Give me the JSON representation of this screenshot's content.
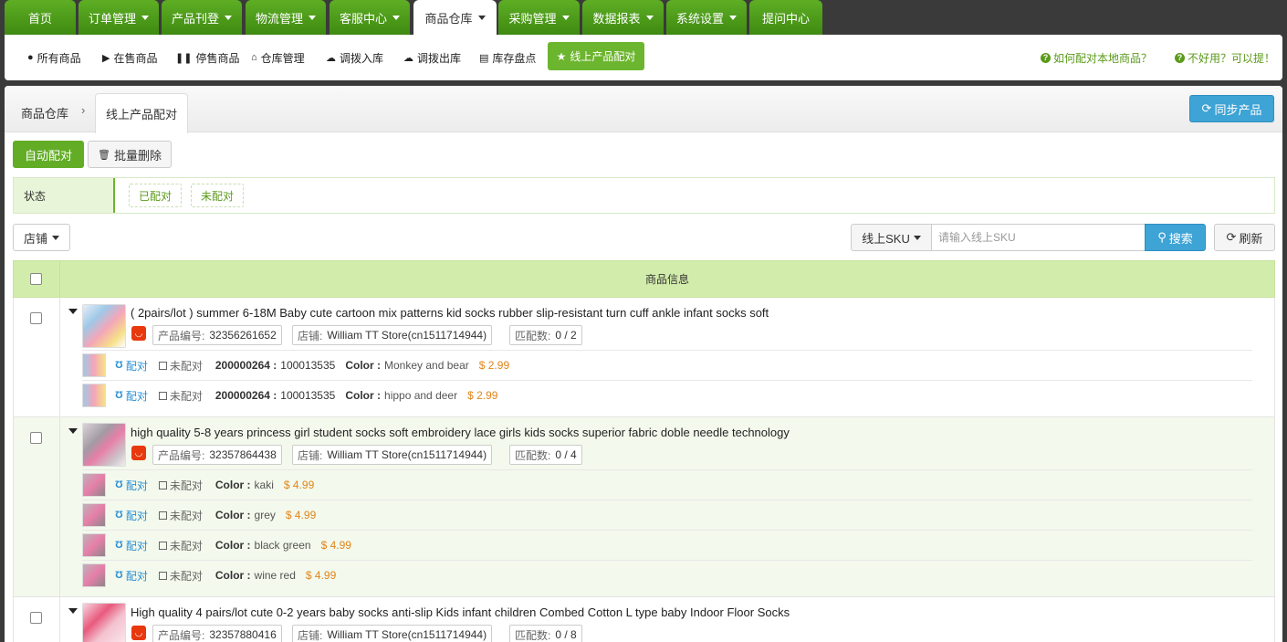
{
  "topnav": {
    "tabs": [
      {
        "label": "首页",
        "dropdown": false
      },
      {
        "label": "订单管理",
        "dropdown": true
      },
      {
        "label": "产品刊登",
        "dropdown": true
      },
      {
        "label": "物流管理",
        "dropdown": true
      },
      {
        "label": "客服中心",
        "dropdown": true
      },
      {
        "label": "商品仓库",
        "dropdown": true,
        "active": true
      },
      {
        "label": "采购管理",
        "dropdown": true
      },
      {
        "label": "数据报表",
        "dropdown": true
      },
      {
        "label": "系统设置",
        "dropdown": true
      },
      {
        "label": "提问中心",
        "dropdown": false
      }
    ]
  },
  "subnav": {
    "items": [
      "所有商品",
      "在售商品",
      "停售商品",
      "仓库管理",
      "调拨入库",
      "调拨出库",
      "库存盘点"
    ],
    "active": "线上产品配对",
    "help1": "如何配对本地商品？",
    "help2": "不好用？可以提！"
  },
  "breadcrumb": {
    "root": "商品仓库",
    "sep": "›",
    "current": "线上产品配对"
  },
  "actions": {
    "sync": "同步产品",
    "auto_match": "自动配对",
    "batch_delete": "批量删除"
  },
  "filter": {
    "label": "状态",
    "options": [
      "已配对",
      "未配对"
    ]
  },
  "toolbar": {
    "shop": "店铺",
    "sku_type": "线上SKU",
    "search_placeholder": "请输入线上SKU",
    "search": "搜索",
    "refresh": "刷新"
  },
  "table": {
    "header": "商品信息"
  },
  "labels": {
    "product_no": "产品编号:",
    "shop": "店铺:",
    "match_count": "匹配数:",
    "match": "配对",
    "unmatched": "未配对",
    "color": "Color :"
  },
  "products": [
    {
      "title": "( 2pairs/lot ) summer 6-18M Baby cute cartoon mix patterns kid socks rubber slip-resistant turn cuff ankle infant socks soft",
      "product_no": "32356261652",
      "shop": "William TT Store(cn1511714944)",
      "match_count": "0 / 2",
      "variants": [
        {
          "sku_id": "200000264 :",
          "sku_val": "100013535",
          "color": "Monkey and bear",
          "price": "$ 2.99"
        },
        {
          "sku_id": "200000264 :",
          "sku_val": "100013535",
          "color": "hippo and deer",
          "price": "$ 2.99"
        }
      ]
    },
    {
      "title": "high quality 5-8 years princess girl student socks soft embroidery lace girls kids socks superior fabric doble needle technology",
      "product_no": "32357864438",
      "shop": "William TT Store(cn1511714944)",
      "match_count": "0 / 4",
      "variants": [
        {
          "color": "kaki",
          "price": "$ 4.99"
        },
        {
          "color": "grey",
          "price": "$ 4.99"
        },
        {
          "color": "black green",
          "price": "$ 4.99"
        },
        {
          "color": "wine red",
          "price": "$ 4.99"
        }
      ]
    },
    {
      "title": "High quality 4 pairs/lot cute 0-2 years baby socks anti-slip Kids infant children Combed Cotton L type baby Indoor Floor Socks",
      "product_no": "32357880416",
      "shop": "William TT Store(cn1511714944)",
      "match_count": "0 / 8",
      "variants": []
    }
  ]
}
